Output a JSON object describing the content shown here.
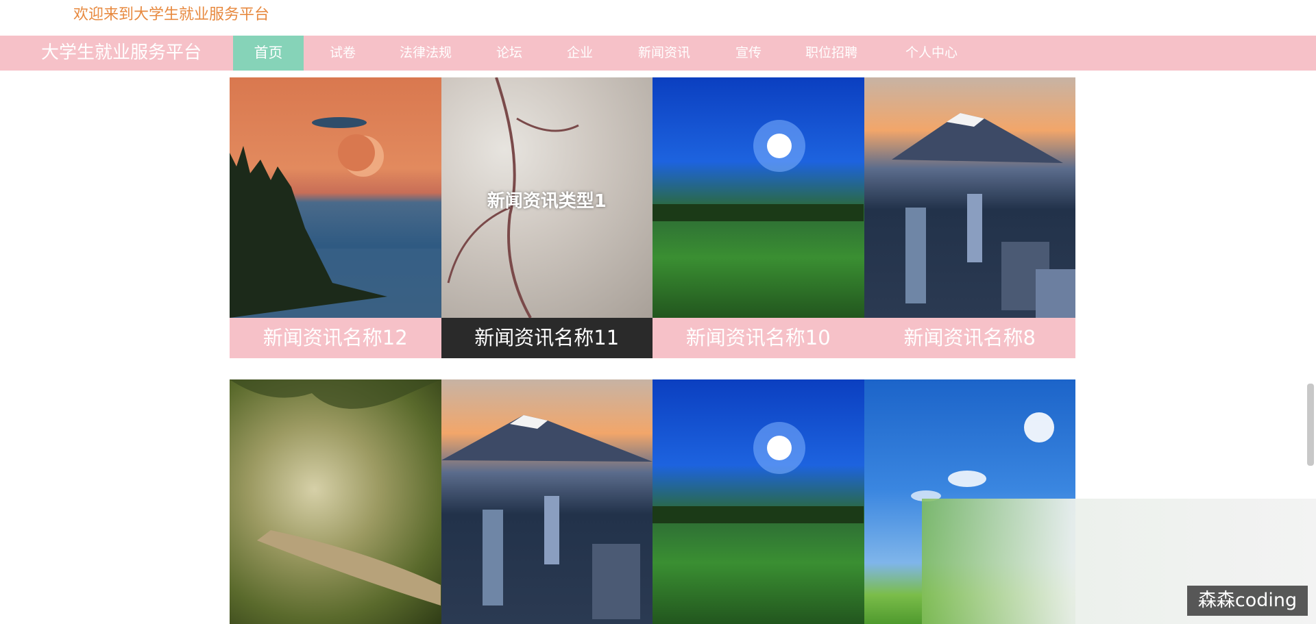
{
  "header": {
    "welcome_text": "欢迎来到大学生就业服务平台"
  },
  "nav": {
    "brand": "大学生就业服务平台",
    "items": [
      {
        "label": "首页",
        "active": true
      },
      {
        "label": "试卷"
      },
      {
        "label": "法律法规"
      },
      {
        "label": "论坛"
      },
      {
        "label": "企业"
      },
      {
        "label": "新闻资讯"
      },
      {
        "label": "宣传"
      },
      {
        "label": "职位招聘"
      },
      {
        "label": "个人中心"
      }
    ]
  },
  "news_grid": {
    "row1": [
      {
        "title": "新闻资讯名称12",
        "image": "lake-sunset"
      },
      {
        "title": "新闻资讯名称11",
        "image": "cherry-blossom",
        "hover_label": "新闻资讯类型1"
      },
      {
        "title": "新闻资讯名称10",
        "image": "night-field"
      },
      {
        "title": "新闻资讯名称8",
        "image": "fuji-city"
      }
    ],
    "row2": [
      {
        "image": "forest-path"
      },
      {
        "image": "fuji-city"
      },
      {
        "image": "night-field"
      },
      {
        "image": "blue-sky-meadow"
      }
    ]
  },
  "watermark": "森森coding",
  "colors": {
    "nav_bg": "#f6c1c8",
    "nav_active": "#86d3b8",
    "welcome": "#e7893f",
    "caption_hover": "#2a2a2a"
  }
}
